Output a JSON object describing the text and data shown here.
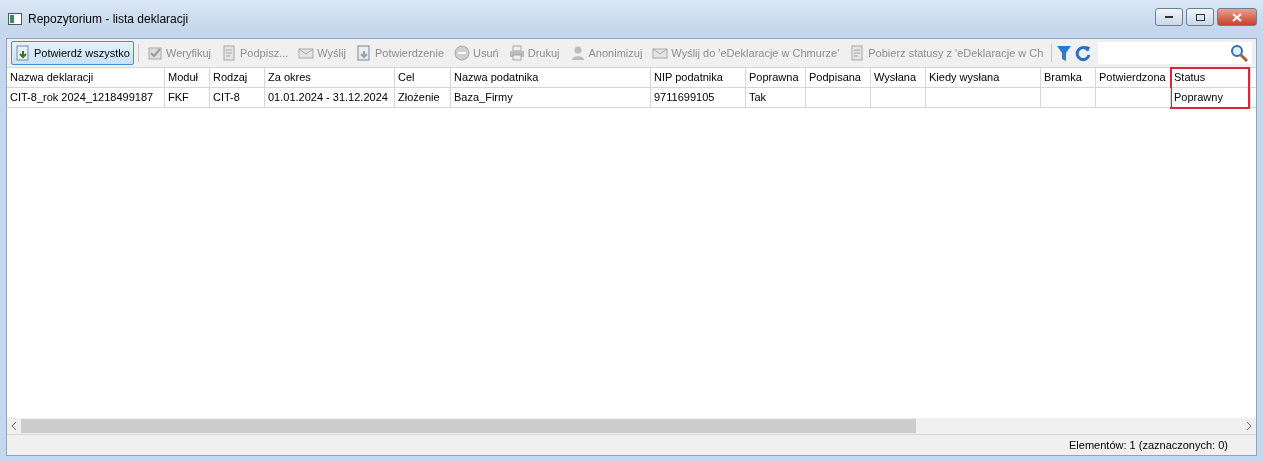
{
  "window": {
    "title": "Repozytorium - lista deklaracji"
  },
  "toolbar": [
    {
      "label": "Potwierdź wszystko",
      "kind": "confirm",
      "disabled": false,
      "selected": true
    },
    {
      "label": "Weryfikuj",
      "kind": "check",
      "disabled": true,
      "selected": false
    },
    {
      "label": "Podpisz...",
      "kind": "sign",
      "disabled": true,
      "selected": false
    },
    {
      "label": "Wyślij",
      "kind": "send",
      "disabled": true,
      "selected": false
    },
    {
      "label": "Potwierdzenie",
      "kind": "confirm",
      "disabled": true,
      "selected": false
    },
    {
      "label": "Usuń",
      "kind": "delete",
      "disabled": true,
      "selected": false
    },
    {
      "label": "Drukuj",
      "kind": "print",
      "disabled": true,
      "selected": false
    },
    {
      "label": "Anonimizuj",
      "kind": "user",
      "disabled": true,
      "selected": false
    },
    {
      "label": "Wyślij do 'eDeklaracje w Chmurze'",
      "kind": "send",
      "disabled": true,
      "selected": false
    },
    {
      "label": "Pobierz statusy z 'eDeklaracje w Ch",
      "kind": "sign",
      "disabled": true,
      "selected": false
    }
  ],
  "table": {
    "columns": [
      {
        "label": "Nazwa deklaracji",
        "highlighted": false
      },
      {
        "label": "Moduł",
        "highlighted": false
      },
      {
        "label": "Rodzaj",
        "highlighted": false
      },
      {
        "label": "Za okres",
        "highlighted": false
      },
      {
        "label": "Cel",
        "highlighted": false
      },
      {
        "label": "Nazwa podatnika",
        "highlighted": false
      },
      {
        "label": "NIP podatnika",
        "highlighted": false
      },
      {
        "label": "Poprawna",
        "highlighted": false
      },
      {
        "label": "Podpisana",
        "highlighted": false
      },
      {
        "label": "Wysłana",
        "highlighted": false
      },
      {
        "label": "Kiedy wysłana",
        "highlighted": false
      },
      {
        "label": "Bramka",
        "highlighted": false
      },
      {
        "label": "Potwierdzona",
        "highlighted": false
      },
      {
        "label": "Status",
        "highlighted": true
      }
    ],
    "rows": [
      {
        "cells": [
          "CIT-8_rok 2024_1218499187",
          "FKF",
          "CIT-8",
          "01.01.2024 - 31.12.2024",
          "Złożenie",
          "Baza_Firmy",
          "9711699105",
          "Tak",
          "",
          "",
          "",
          "",
          "",
          "Poprawny"
        ]
      }
    ]
  },
  "status_bar": "Elementów: 1 (zaznaczonych: 0)"
}
